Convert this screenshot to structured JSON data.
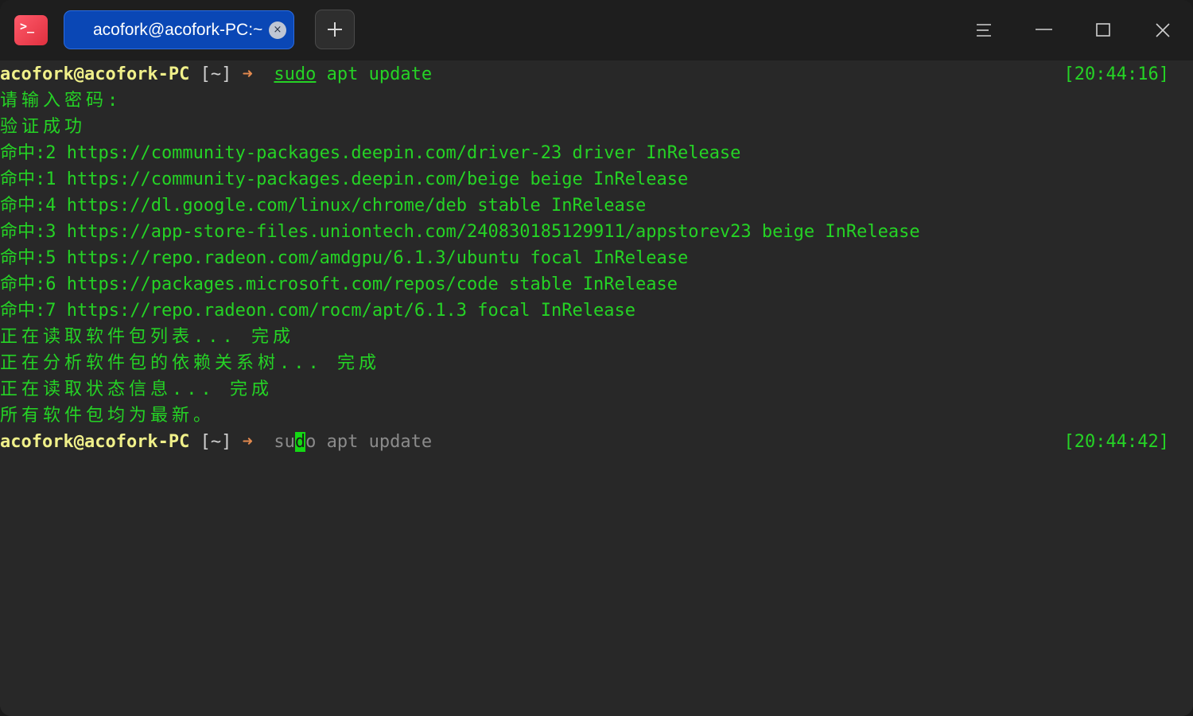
{
  "app": {
    "icon_glyph": ">_",
    "icon_name": "terminal-app-icon",
    "accent_color": "#0a47b5"
  },
  "tabs": [
    {
      "title": "acofork@acofork-PC:~",
      "close_glyph": "×"
    }
  ],
  "titlebar": {
    "new_tab_glyph": "+",
    "menu_icon": "hamburger-menu-icon",
    "minimize_icon": "minimize-icon",
    "maximize_icon": "maximize-icon",
    "close_icon": "close-icon"
  },
  "terminal": {
    "prompt1": {
      "user_host": "acofork@acofork-PC",
      "dir": "[~]",
      "arrow": "➜",
      "cmd_sudo": "sudo",
      "cmd_rest": " apt update",
      "timestamp": "[20:44:16]"
    },
    "output": [
      "请输入密码:",
      "验证成功",
      "命中:2 https://community-packages.deepin.com/driver-23 driver InRelease",
      "命中:1 https://community-packages.deepin.com/beige beige InRelease",
      "命中:4 https://dl.google.com/linux/chrome/deb stable InRelease",
      "命中:3 https://app-store-files.uniontech.com/240830185129911/appstorev23 beige InRelease",
      "命中:5 https://repo.radeon.com/amdgpu/6.1.3/ubuntu focal InRelease",
      "命中:6 https://packages.microsoft.com/repos/code stable InRelease",
      "命中:7 https://repo.radeon.com/rocm/apt/6.1.3 focal InRelease",
      "正在读取软件包列表... 完成",
      "正在分析软件包的依赖关系树... 完成",
      "正在读取状态信息... 完成",
      "所有软件包均为最新。"
    ],
    "prompt2": {
      "user_host": "acofork@acofork-PC",
      "dir": "[~]",
      "arrow": "➜",
      "typed": "su",
      "cursor_char": "d",
      "suggestion": "o apt update",
      "timestamp": "[20:44:42]"
    }
  }
}
